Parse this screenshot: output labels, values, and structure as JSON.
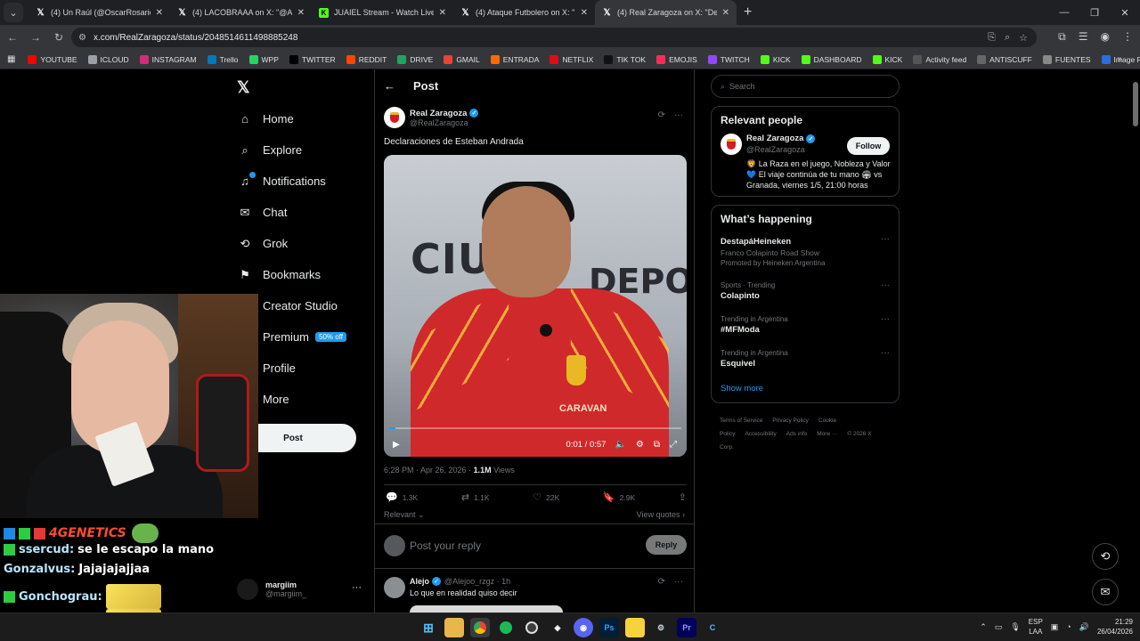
{
  "browser": {
    "tabs": [
      {
        "label": "(4) Un Raúl (@OscarRosario56)",
        "favicon": "x-icon"
      },
      {
        "label": "(4) LACOBRAAA on X: \"@Ataqu",
        "favicon": "x-icon"
      },
      {
        "label": "JUAIEL Stream - Watch Live on",
        "favicon": "kick-icon"
      },
      {
        "label": "(4) Ataque Futbolero on X: \"Est",
        "favicon": "x-icon"
      },
      {
        "label": "(4) Real Zaragoza on X: \"Declar",
        "favicon": "x-icon",
        "active": true
      }
    ],
    "url": "x.com/RealZaragoza/status/2048514611498885248",
    "bookmarks": [
      {
        "label": "YOUTUBE",
        "color": "#ff0000"
      },
      {
        "label": "ICLOUD",
        "color": "#9aa0a6"
      },
      {
        "label": "INSTAGRAM",
        "color": "#d62976"
      },
      {
        "label": "Trello",
        "color": "#0079bf"
      },
      {
        "label": "WPP",
        "color": "#25d366"
      },
      {
        "label": "TWITTER",
        "color": "#000000"
      },
      {
        "label": "REDDIT",
        "color": "#ff4500"
      },
      {
        "label": "DRIVE",
        "color": "#1fa463"
      },
      {
        "label": "GMAIL",
        "color": "#ea4335"
      },
      {
        "label": "ENTRADA",
        "color": "#ff6a00"
      },
      {
        "label": "NETFLIX",
        "color": "#e50914"
      },
      {
        "label": "TIK TOK",
        "color": "#111111"
      },
      {
        "label": "EMOJIS",
        "color": "#ff2d55"
      },
      {
        "label": "TWITCH",
        "color": "#9146ff"
      },
      {
        "label": "KICK",
        "color": "#53fc18"
      },
      {
        "label": "DASHBOARD",
        "color": "#53fc18"
      },
      {
        "label": "KICK",
        "color": "#53fc18"
      },
      {
        "label": "Activity feed",
        "color": "#555555"
      },
      {
        "label": "ANTISCUFF",
        "color": "#666666"
      },
      {
        "label": "FUENTES",
        "color": "#888888"
      },
      {
        "label": "Image Resizer | Resi...",
        "color": "#2d6cdf"
      }
    ]
  },
  "x": {
    "nav": [
      {
        "label": "Home",
        "icon": "home-icon"
      },
      {
        "label": "Explore",
        "icon": "search-icon"
      },
      {
        "label": "Notifications",
        "icon": "bell-icon",
        "dot": true
      },
      {
        "label": "Chat",
        "icon": "chat-icon"
      },
      {
        "label": "Grok",
        "icon": "grok-icon"
      },
      {
        "label": "Bookmarks",
        "icon": "bookmark-icon"
      },
      {
        "label": "Creator Studio",
        "icon": "studio-icon"
      },
      {
        "label": "Premium",
        "icon": "x-premium-icon",
        "badge": "50% off"
      },
      {
        "label": "Profile",
        "icon": "profile-icon"
      },
      {
        "label": "More",
        "icon": "more-icon"
      }
    ],
    "post_button": "Post",
    "account": {
      "name": "margiim",
      "handle": "@margiim_"
    },
    "post": {
      "header": "Post",
      "author_name": "Real Zaragoza",
      "author_handle": "@RealZaragoza",
      "text": "Declaraciones de Esteban Andrada",
      "video": {
        "time": "0:01 / 0:57",
        "progress": 0.02,
        "brand": "CARAVAN"
      },
      "timestamp": "6:28 PM · Apr 26, 2026 · ",
      "views_count": "1.1M",
      "views_label": " Views",
      "stats": {
        "replies": "1.3K",
        "reposts": "1.1K",
        "likes": "22K",
        "bookmarks": "2.9K"
      },
      "relevant": "Relevant",
      "view_quotes": "View quotes"
    },
    "reply": {
      "placeholder": "Post your reply",
      "button": "Reply"
    },
    "comment": {
      "name": "Alejo",
      "handle": "@Alejoo_rzgz · 1h",
      "text": "Lo que en realidad quiso decir"
    },
    "search_placeholder": "Search",
    "relevant_people": {
      "title": "Relevant people",
      "name": "Real Zaragoza",
      "handle": "@RealZaragoza",
      "follow": "Follow",
      "bio": "🦁 La Raza en el juego, Nobleza y Valor 💙 El viaje continúa de tu mano 🏟 vs Granada, viernes 1/5, 21:00 horas"
    },
    "happening": {
      "title": "What’s happening",
      "trends": [
        {
          "context": "",
          "name": "DestapáHeineken",
          "sub": "Franco Colapinto Road Show",
          "promo": "Promoted by Heineken Argentina"
        },
        {
          "context": "Sports · Trending",
          "name": "Colapinto"
        },
        {
          "context": "Trending in Argentina",
          "name": "#MFModa"
        },
        {
          "context": "Trending in Argentina",
          "name": "Esquivel"
        }
      ],
      "show_more": "Show more"
    },
    "footer": [
      "Terms of Service",
      "Privacy Policy",
      "Cookie Policy",
      "Accessibility",
      "Ads info",
      "More ···",
      "© 2026 X Corp."
    ]
  },
  "stream_chat": [
    {
      "user": "",
      "msg": "4GENETICS",
      "type": "genetics"
    },
    {
      "user": "ssercud:",
      "msg": "se le escapo la mano"
    },
    {
      "user": "Gonzalvus:",
      "msg": "Jajajajajjaa"
    },
    {
      "user": "Gonchograu:",
      "msg": "",
      "emote": true
    },
    {
      "user": "Gonchograu:",
      "msg": "",
      "emote": true
    }
  ],
  "taskbar": {
    "lang": "ESP",
    "layout": "LAA",
    "time": "21:29",
    "date": "26/04/2026"
  }
}
